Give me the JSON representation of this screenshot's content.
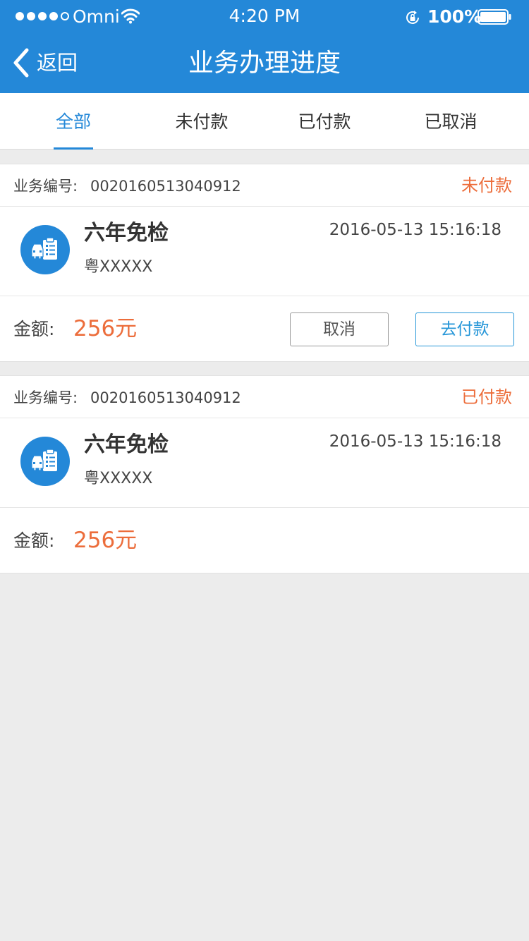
{
  "status_bar": {
    "carrier": "Omni",
    "time": "4:20 PM",
    "battery": "100%",
    "signal_dots_filled": 4,
    "signal_dots_total": 5
  },
  "nav": {
    "back_label": "返回",
    "title": "业务办理进度"
  },
  "tabs": [
    {
      "label": "全部",
      "active": true
    },
    {
      "label": "未付款",
      "active": false
    },
    {
      "label": "已付款",
      "active": false
    },
    {
      "label": "已取消",
      "active": false
    }
  ],
  "orders": [
    {
      "order_no_label": "业务编号:",
      "order_no": "0020160513040912",
      "status": "未付款",
      "service_name": "六年免检",
      "plate": "粤XXXXX",
      "time": "2016-05-13 15:16:18",
      "amount_label": "金额:",
      "amount": "256元",
      "cancel_label": "取消",
      "pay_label": "去付款"
    },
    {
      "order_no_label": "业务编号:",
      "order_no": "0020160513040912",
      "status": "已付款",
      "service_name": "六年免检",
      "plate": "粤XXXXX",
      "time": "2016-05-13 15:16:18",
      "amount_label": "金额:",
      "amount": "256元"
    }
  ],
  "colors": {
    "primary": "#2488d8",
    "accent_orange": "#ec6d3b",
    "background": "#ececec"
  },
  "icons": {
    "service": "car-clipboard-icon",
    "back": "chevron-left-icon",
    "wifi": "wifi-icon",
    "rotation_lock": "rotation-lock-icon",
    "battery": "battery-icon"
  }
}
